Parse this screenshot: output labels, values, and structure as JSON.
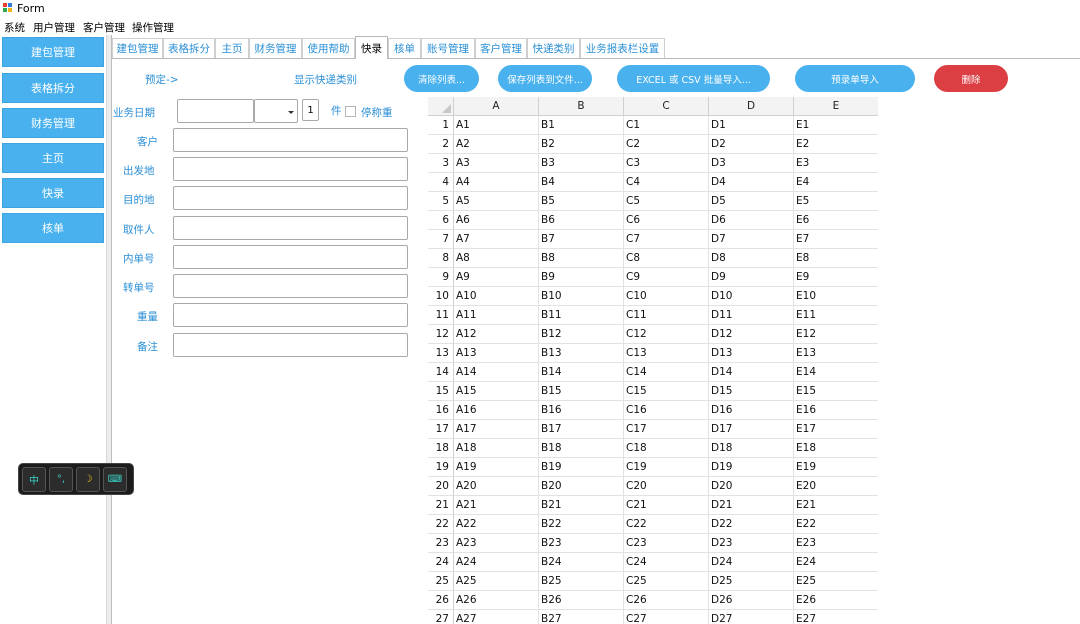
{
  "window": {
    "title": "Form"
  },
  "menu": [
    "系统",
    "用户管理",
    "客户管理",
    "操作管理"
  ],
  "sidebar": {
    "items": [
      "建包管理",
      "表格拆分",
      "财务管理",
      "主页",
      "快录",
      "核单"
    ]
  },
  "tabs": [
    {
      "label": "建包管理"
    },
    {
      "label": "表格拆分"
    },
    {
      "label": "主页"
    },
    {
      "label": "财务管理"
    },
    {
      "label": "使用帮助"
    },
    {
      "label": "快录",
      "active": true
    },
    {
      "label": "核单"
    },
    {
      "label": "账号管理"
    },
    {
      "label": "客户管理"
    },
    {
      "label": "快递类别"
    },
    {
      "label": "业务报表栏设置"
    }
  ],
  "toolbar": {
    "preset_label": "预定->",
    "show_courier_label": "显示快递类别",
    "clear_list": "清除列表...",
    "save_list": "保存列表到文件...",
    "import_excel": "EXCEL 或 CSV 批量导入...",
    "preorder_import": "预录单导入",
    "delete": "删除"
  },
  "form": {
    "business_date_label": "业务日期",
    "count_value": "1",
    "count_unit": "件",
    "dup_label": "停称重",
    "customer_label": "客户",
    "origin_label": "出发地",
    "destination_label": "目的地",
    "pickup_label": "取件人",
    "inner_no_label": "内单号",
    "transfer_no_label": "转单号",
    "weight_label": "重量",
    "remark_label": "备注"
  },
  "grid": {
    "columns": [
      "A",
      "B",
      "C",
      "D",
      "E"
    ],
    "row_count": 27,
    "cell_pattern": "column + row number"
  },
  "ime": {
    "keys": [
      "中",
      "°,",
      "☽",
      "⌨"
    ]
  },
  "colors": {
    "accent": "#49b1ee",
    "danger": "#dc3f43",
    "link": "#2a8fd6"
  }
}
